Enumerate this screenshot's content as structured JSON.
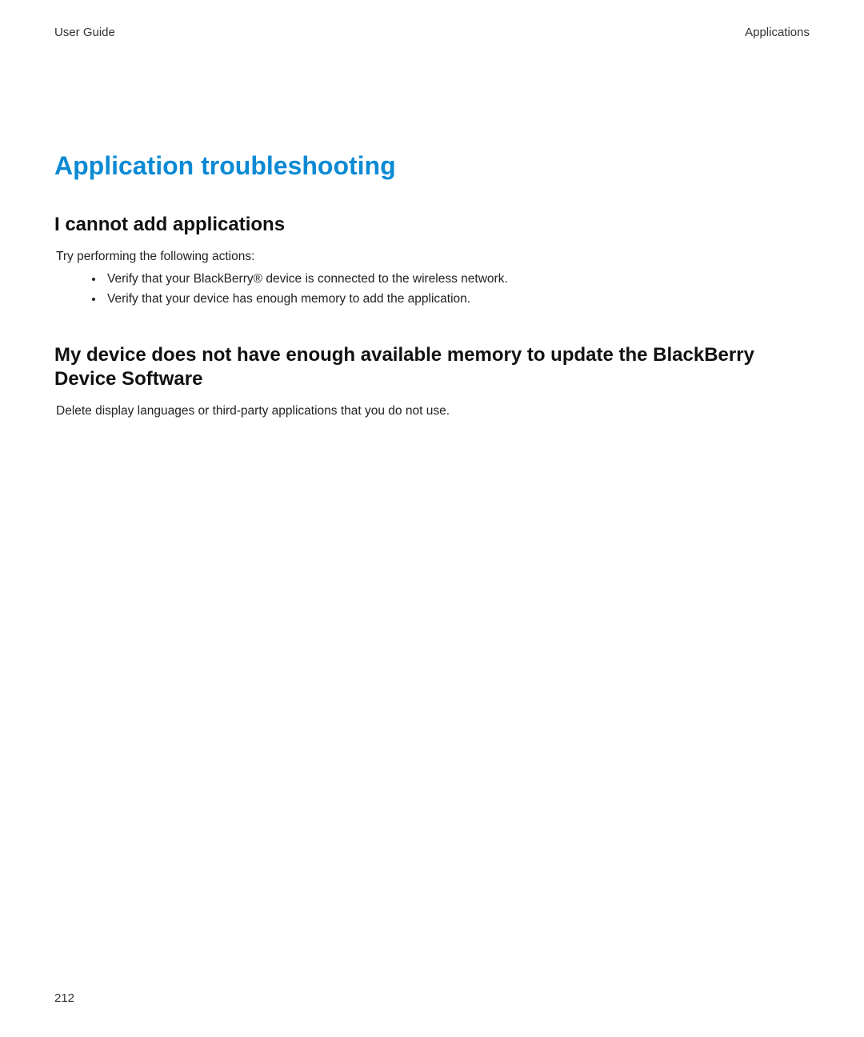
{
  "header": {
    "left": "User Guide",
    "right": "Applications"
  },
  "title": "Application troubleshooting",
  "sections": [
    {
      "heading": "I cannot add applications",
      "intro": "Try performing the following actions:",
      "bullets": [
        "Verify that your BlackBerry® device is connected to the wireless network.",
        "Verify that your device has enough memory to add the application."
      ]
    },
    {
      "heading": "My device does not have enough available memory to update the BlackBerry Device Software",
      "paragraph": "Delete display languages or third-party applications that you do not use."
    }
  ],
  "page_number": "212"
}
